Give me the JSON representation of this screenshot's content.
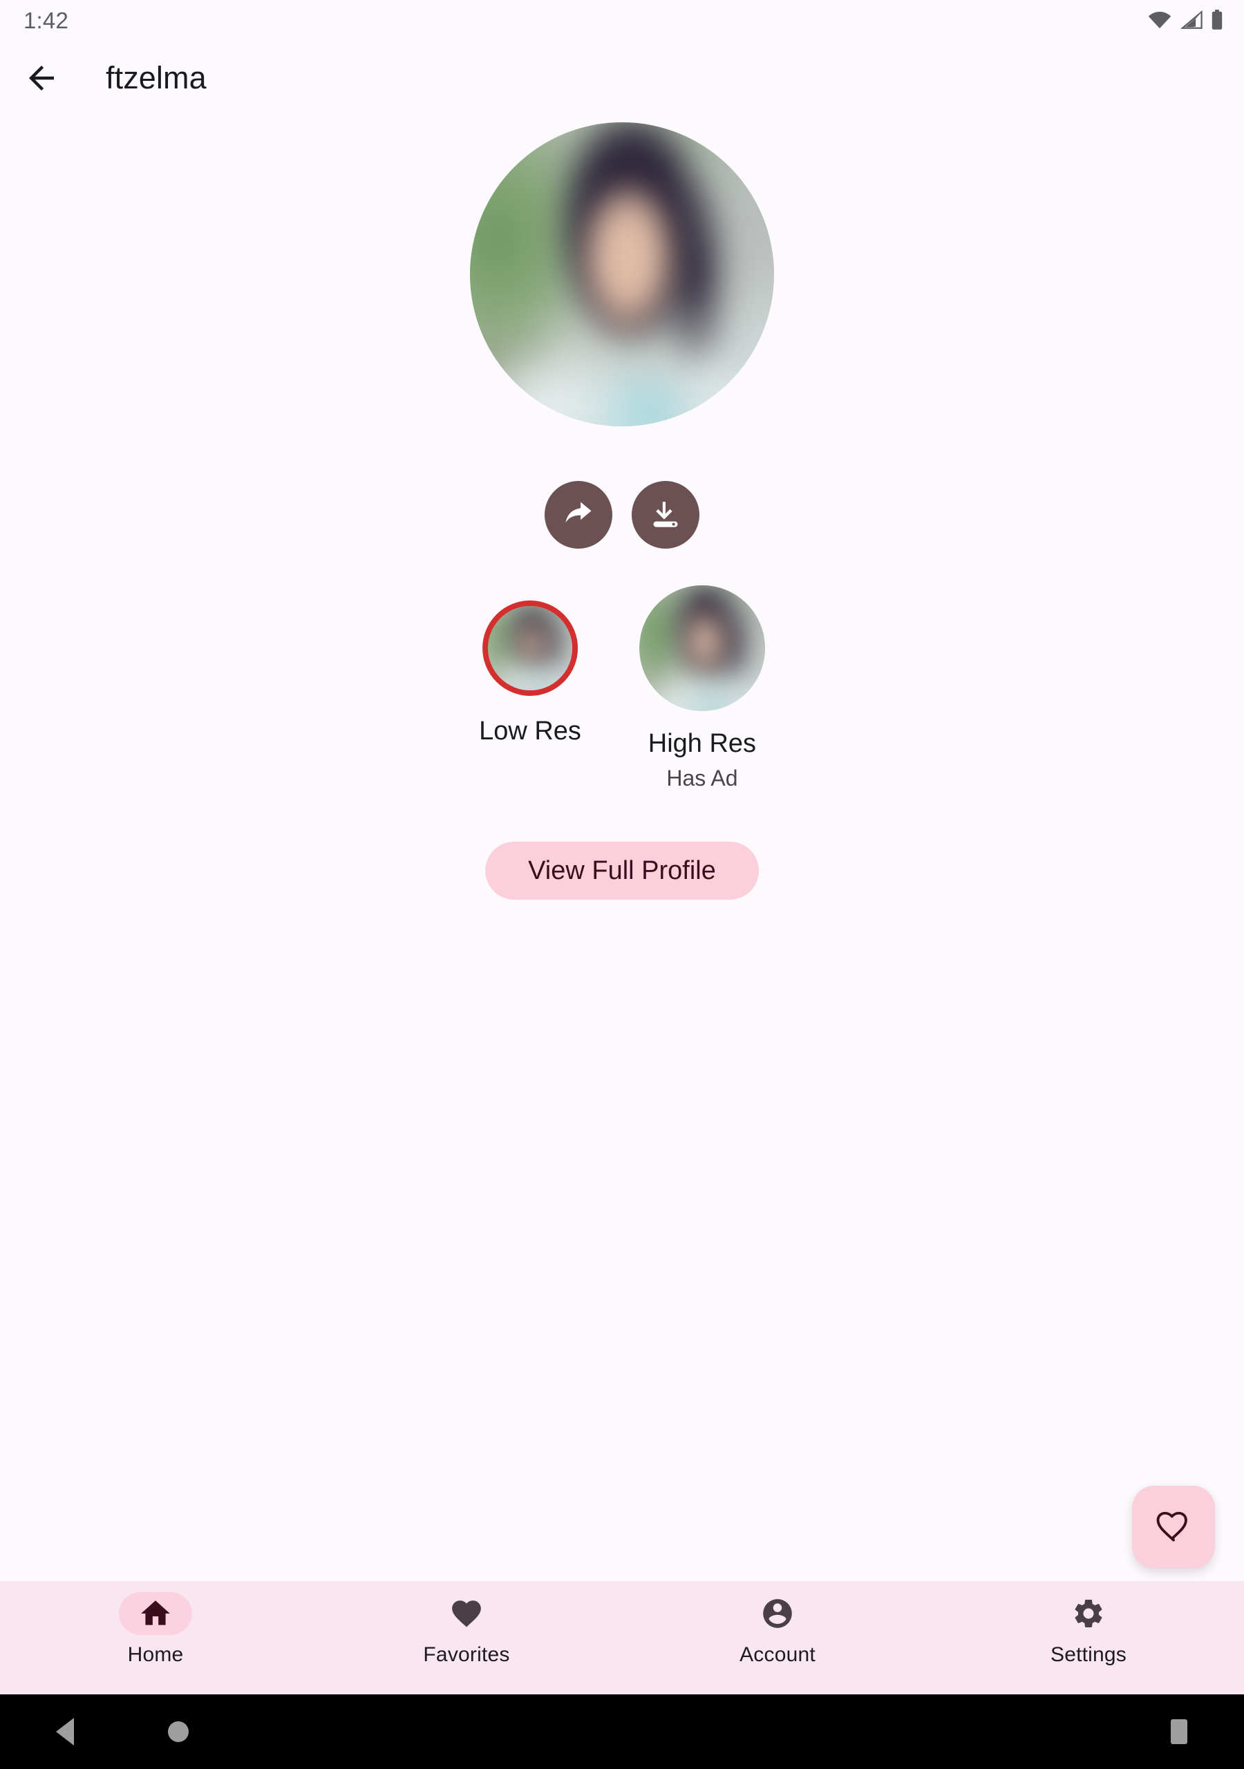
{
  "status_bar": {
    "time": "1:42",
    "icons": [
      "wifi-icon",
      "cellular-signal-icon",
      "battery-icon"
    ]
  },
  "app_bar": {
    "back_icon": "arrow-back-icon",
    "title": "ftzelma"
  },
  "hero": {
    "avatar_alt": "profile-photo",
    "actions": [
      {
        "name": "share",
        "icon": "share-arrow-icon"
      },
      {
        "name": "download",
        "icon": "download-icon"
      }
    ]
  },
  "resolutions": [
    {
      "label": "Low Res",
      "subtitle": "",
      "selected": true,
      "ring_color": "#D32F2F"
    },
    {
      "label": "High Res",
      "subtitle": "Has Ad",
      "selected": false,
      "ring_color": ""
    }
  ],
  "profile_button": {
    "label": "View Full Profile",
    "bg_color": "#FBCFDC",
    "text_color": "#3B0E1C"
  },
  "fab": {
    "icon": "heart-outline-icon",
    "bg_color": "#FBD0DD"
  },
  "bottom_nav": {
    "bg_color": "#F9E6F0",
    "items": [
      {
        "label": "Home",
        "icon": "home-icon",
        "active": true
      },
      {
        "label": "Favorites",
        "icon": "heart-filled-icon",
        "active": false
      },
      {
        "label": "Account",
        "icon": "account-circle-icon",
        "active": false
      },
      {
        "label": "Settings",
        "icon": "gear-icon",
        "active": false
      }
    ]
  },
  "system_nav": {
    "back_icon": "triangle-back-icon",
    "home_icon": "circle-home-icon",
    "recents_icon": "square-recents-icon"
  }
}
